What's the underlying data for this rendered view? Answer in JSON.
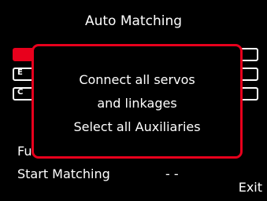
{
  "screen": {
    "title": "Auto Matching",
    "background_color": "#000000",
    "accent_color": "#e8001c"
  },
  "list": {
    "tabs": [
      {
        "letter": "",
        "active": true
      },
      {
        "letter": "E",
        "active": false
      },
      {
        "letter": "C",
        "active": false
      }
    ],
    "rows": [
      {
        "label": "Fu",
        "value": ""
      },
      {
        "label": "Start Matching",
        "value": "- -"
      }
    ]
  },
  "footer": {
    "exit_label": "Exit"
  },
  "popup": {
    "lines": [
      "Connect all servos",
      "and linkages",
      "Select all Auxiliaries"
    ]
  }
}
